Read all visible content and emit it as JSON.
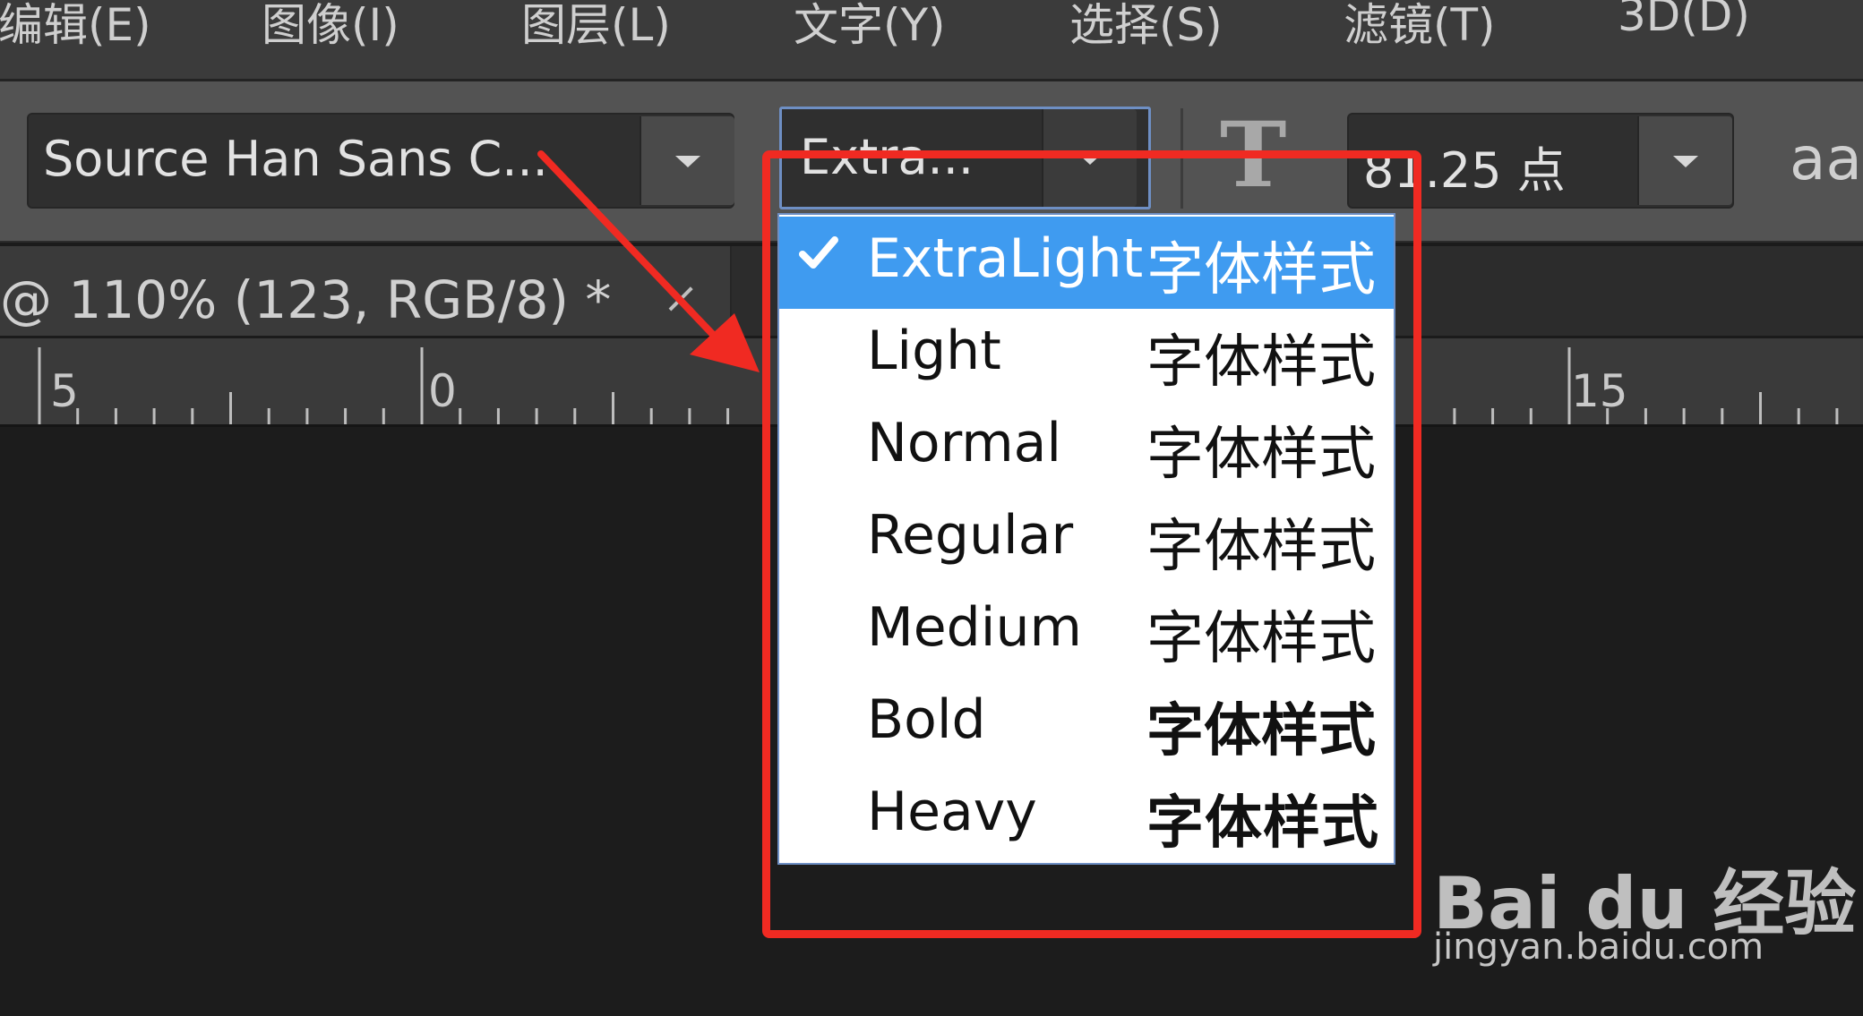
{
  "menubar": {
    "items": [
      "编辑(E)",
      "图像(I)",
      "图层(L)",
      "文字(Y)",
      "选择(S)",
      "滤镜(T)",
      "3D(D)"
    ]
  },
  "options_bar": {
    "font_family": "Source Han Sans C...",
    "font_style": "Extra...",
    "font_size": "81.25 点",
    "text_orient_icon": "T",
    "antialias_icon": "aa"
  },
  "document_tab": {
    "title": "@ 110% (123, RGB/8) *",
    "close_label": "×"
  },
  "ruler": {
    "labels": [
      "5",
      "0",
      "15"
    ]
  },
  "font_style_dropdown": {
    "selected": "ExtraLight",
    "items": [
      {
        "name": "ExtraLight",
        "sample": "字体样式"
      },
      {
        "name": "Light",
        "sample": "字体样式"
      },
      {
        "name": "Normal",
        "sample": "字体样式"
      },
      {
        "name": "Regular",
        "sample": "字体样式"
      },
      {
        "name": "Medium",
        "sample": "字体样式"
      },
      {
        "name": "Bold",
        "sample": "字体样式"
      },
      {
        "name": "Heavy",
        "sample": "字体样式"
      }
    ]
  },
  "watermark": {
    "logo": "Bai du 经验",
    "url": "jingyan.baidu.com"
  },
  "colors": {
    "highlight": "#3f9bf0",
    "annotation_red": "#f02a22",
    "focus_border": "#6e8fc4"
  }
}
